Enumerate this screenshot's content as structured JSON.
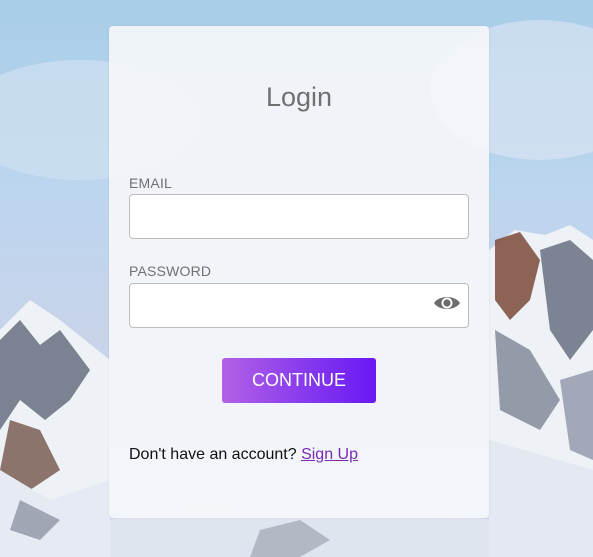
{
  "login": {
    "title": "Login",
    "email_label": "EMAIL",
    "email_value": "",
    "password_label": "PASSWORD",
    "password_value": "",
    "continue_label": "CONTINUE",
    "signup_prompt": "Don't have an account?",
    "signup_link": "Sign Up",
    "password_toggle_icon": "eye-icon"
  },
  "colors": {
    "button_gradient_start": "#b261e5",
    "button_gradient_end": "#6a18f5",
    "link": "#7a2ab5"
  }
}
